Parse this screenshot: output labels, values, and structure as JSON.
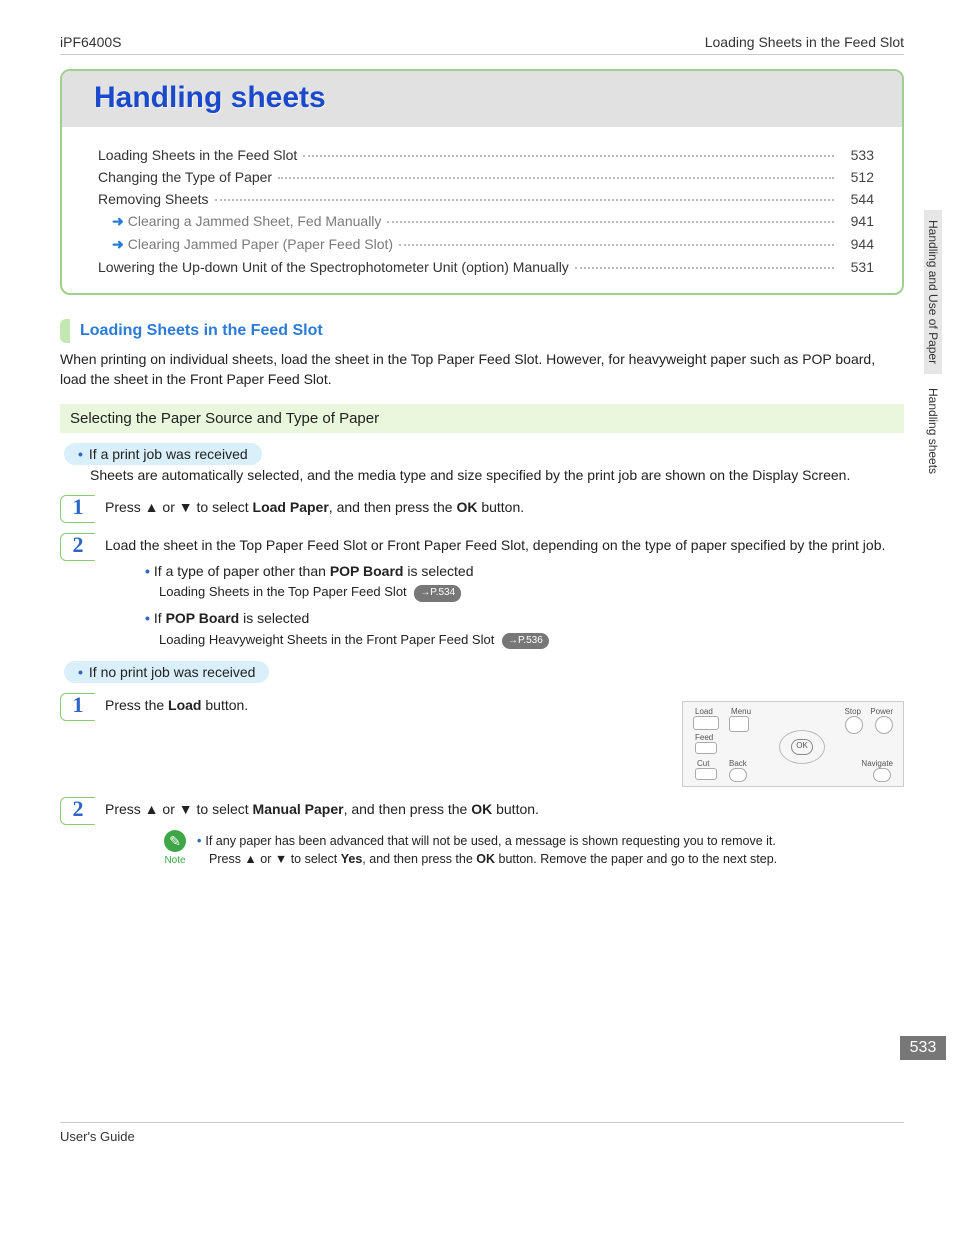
{
  "header": {
    "left": "iPF6400S",
    "right": "Loading Sheets in the Feed Slot"
  },
  "chapter_title": "Handling sheets",
  "toc": [
    {
      "label": "Loading Sheets in the Feed Slot",
      "page": "533",
      "sub": false
    },
    {
      "label": "Changing the Type of Paper",
      "page": "512",
      "sub": false
    },
    {
      "label": "Removing Sheets",
      "page": "544",
      "sub": false
    },
    {
      "label": "Clearing a Jammed Sheet, Fed Manually",
      "page": "941",
      "sub": true
    },
    {
      "label": "Clearing Jammed Paper (Paper Feed Slot)",
      "page": "944",
      "sub": true
    },
    {
      "label": "Lowering the Up-down Unit of the Spectrophotometer Unit (option) Manually",
      "page": "531",
      "sub": false
    }
  ],
  "section_heading": "Loading Sheets in the Feed Slot",
  "intro": "When printing on individual sheets, load the sheet in the Top Paper Feed Slot. However, for heavyweight paper such as POP board, load the sheet in the Front Paper Feed Slot.",
  "sub_heading": "Selecting the Paper Source and Type of Paper",
  "cond1": {
    "label": "If a print job was received",
    "body": "Sheets are automatically selected, and the media type and size specified by the print job are shown on the Display Screen."
  },
  "cond1_steps": {
    "s1_pre": "Press ▲ or ▼ to select ",
    "s1_bold": "Load Paper",
    "s1_post": ", and then press the ",
    "s1_bold2": "OK",
    "s1_end": " button.",
    "s2": "Load the sheet in the Top Paper Feed Slot or Front Paper Feed Slot, depending on the type of paper specified by the print job.",
    "s2a_pre": "If a type of paper other than ",
    "s2a_bold": "POP Board",
    "s2a_post": " is selected",
    "s2a_detail": "Loading Sheets in the Top Paper Feed Slot",
    "s2a_ref": "→P.534",
    "s2b_pre": "If ",
    "s2b_bold": "POP Board",
    "s2b_post": " is selected",
    "s2b_detail": "Loading Heavyweight Sheets in the Front Paper Feed Slot",
    "s2b_ref": "→P.536"
  },
  "cond2": {
    "label": "If no print job was received"
  },
  "cond2_steps": {
    "s1_pre": "Press the ",
    "s1_bold": "Load",
    "s1_post": " button.",
    "s2_pre": "Press ▲ or ▼ to select ",
    "s2_bold": "Manual Paper",
    "s2_post": ", and then press the ",
    "s2_bold2": "OK",
    "s2_end": " button."
  },
  "note": {
    "label": "Note",
    "line1": "If any paper has been advanced that will not be used, a message is shown requesting you to remove it.",
    "line2_pre": "Press ▲ or ▼ to select ",
    "line2_bold": "Yes",
    "line2_mid": ", and then press the ",
    "line2_bold2": "OK",
    "line2_end": " button. Remove the paper and go to the next step."
  },
  "panel": {
    "Load": "Load",
    "Menu": "Menu",
    "Feed": "Feed",
    "Cut": "Cut",
    "Back": "Back",
    "OK": "OK",
    "Stop": "Stop",
    "Power": "Power",
    "Navigate": "Navigate"
  },
  "side_tabs": {
    "t1": "Handling and Use of Paper",
    "t2": "Handling sheets"
  },
  "page_number": "533",
  "footer": "User's Guide"
}
